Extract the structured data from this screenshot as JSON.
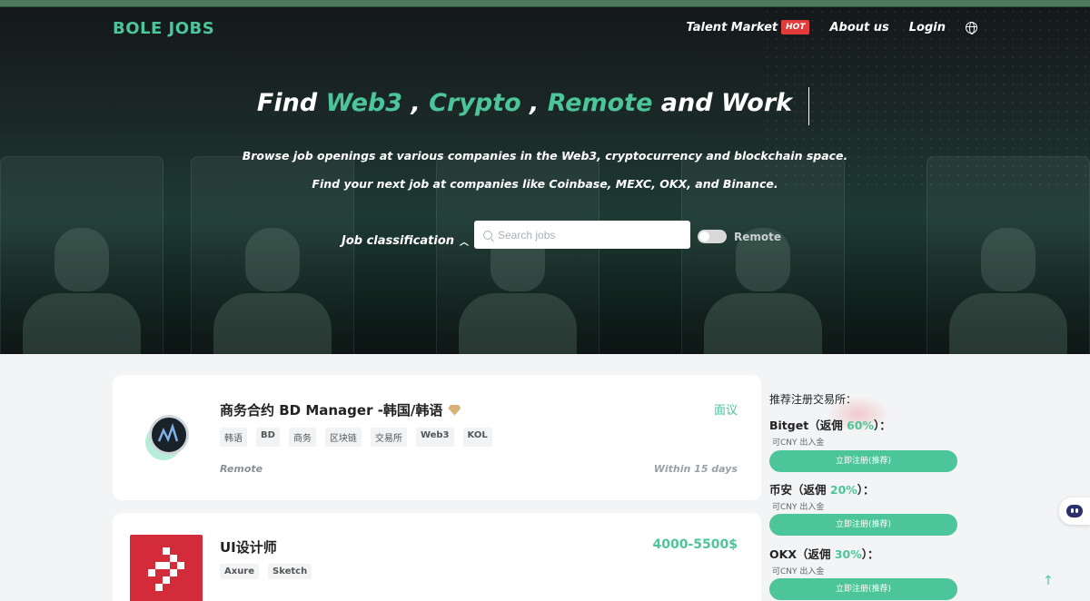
{
  "nav": {
    "logo": "BOLE JOBS",
    "items": [
      {
        "label": "Talent Market",
        "badge": "HOT"
      },
      {
        "label": "About us"
      },
      {
        "label": "Login"
      }
    ],
    "language_icon": "globe-icon"
  },
  "hero": {
    "title_find": "Find",
    "title_web3": "Web3",
    "title_sep1": ",",
    "title_crypto": "Crypto",
    "title_sep2": ",",
    "title_remote": "Remote",
    "title_end": "and Work",
    "desc": "Browse job openings at various companies in the Web3, cryptocurrency and blockchain space. Find your next job at companies like Coinbase, MEXC, OKX, and Binance.",
    "job_classification": "Job classification",
    "search_placeholder": "Search jobs",
    "remote_label": "Remote"
  },
  "jobs": [
    {
      "title": "商务合约 BD Manager -韩国/韩语",
      "salary": "面议",
      "tags": [
        "韩语",
        "BD",
        "商务",
        "区块链",
        "交易所",
        "Web3",
        "KOL"
      ],
      "location": "Remote",
      "posted": "Within 15 days"
    },
    {
      "title": "UI设计师",
      "salary": "4000-5500$",
      "tags": [
        "Axure",
        "Sketch"
      ]
    }
  ],
  "sidebar": {
    "title": "推荐注册交易所：",
    "exchanges": [
      {
        "name": "Bitget",
        "pre": "（返佣 ",
        "pct": "60%",
        "post": "）：",
        "sub": "可CNY 出入金",
        "button": "立即注册(推荐)"
      },
      {
        "name": "币安",
        "pre": "（返佣 ",
        "pct": "20%",
        "post": "）：",
        "sub": "可CNY 出入金",
        "button": "立即注册(推荐)"
      },
      {
        "name": "OKX",
        "pre": "（返佣 ",
        "pct": "30%",
        "post": "）：",
        "sub": "可CNY 出入金",
        "button": "立即注册(推荐)"
      }
    ]
  },
  "colors": {
    "accent": "#4dc59a",
    "hot": "#e23b3b"
  }
}
